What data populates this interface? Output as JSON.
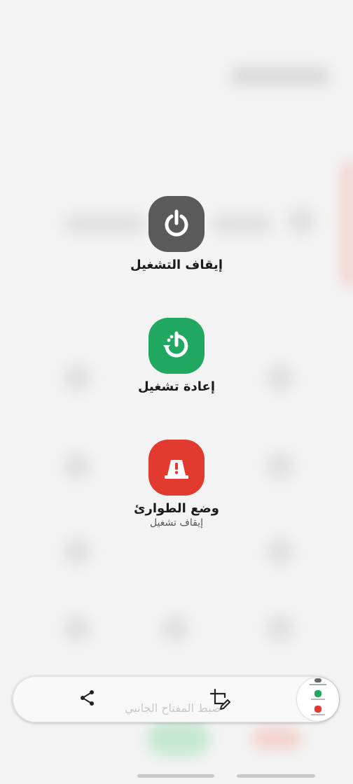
{
  "power_menu": {
    "power_off": {
      "label": "إيقاف التشغيل",
      "icon": "power-icon",
      "color": "#5a5a5a"
    },
    "restart": {
      "label": "إعادة تشغيل",
      "icon": "restart-icon",
      "color": "#21a860"
    },
    "emergency": {
      "label": "وضع الطوارئ",
      "sublabel": "إيقاف تشغيل",
      "icon": "emergency-icon",
      "color": "#e23a2f"
    }
  },
  "toolbar": {
    "share_icon": "share-icon",
    "edit_icon": "crop-edit-icon",
    "hint_text": "ضبط المفتاح الجانبي"
  }
}
